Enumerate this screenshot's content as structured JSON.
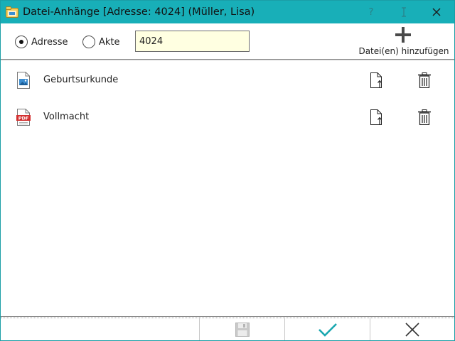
{
  "window": {
    "title": "Datei-Anhänge [Adresse: 4024] (Müller, Lisa)",
    "help_label": "?",
    "accent_color": "#18afb8"
  },
  "toolbar": {
    "radio_adresse_label": "Adresse",
    "radio_akte_label": "Akte",
    "selected_radio": "Adresse",
    "id_value": "4024",
    "add_files_label": "Datei(en) hinzufügen"
  },
  "files": [
    {
      "name": "Geburtsurkunde",
      "icon": "image-file-icon"
    },
    {
      "name": "Vollmacht",
      "icon": "pdf-file-icon",
      "icon_badge": "PDF"
    }
  ],
  "bottom": {
    "save_icon": "save-icon",
    "ok_icon": "checkmark-icon",
    "cancel_icon": "close-icon"
  }
}
